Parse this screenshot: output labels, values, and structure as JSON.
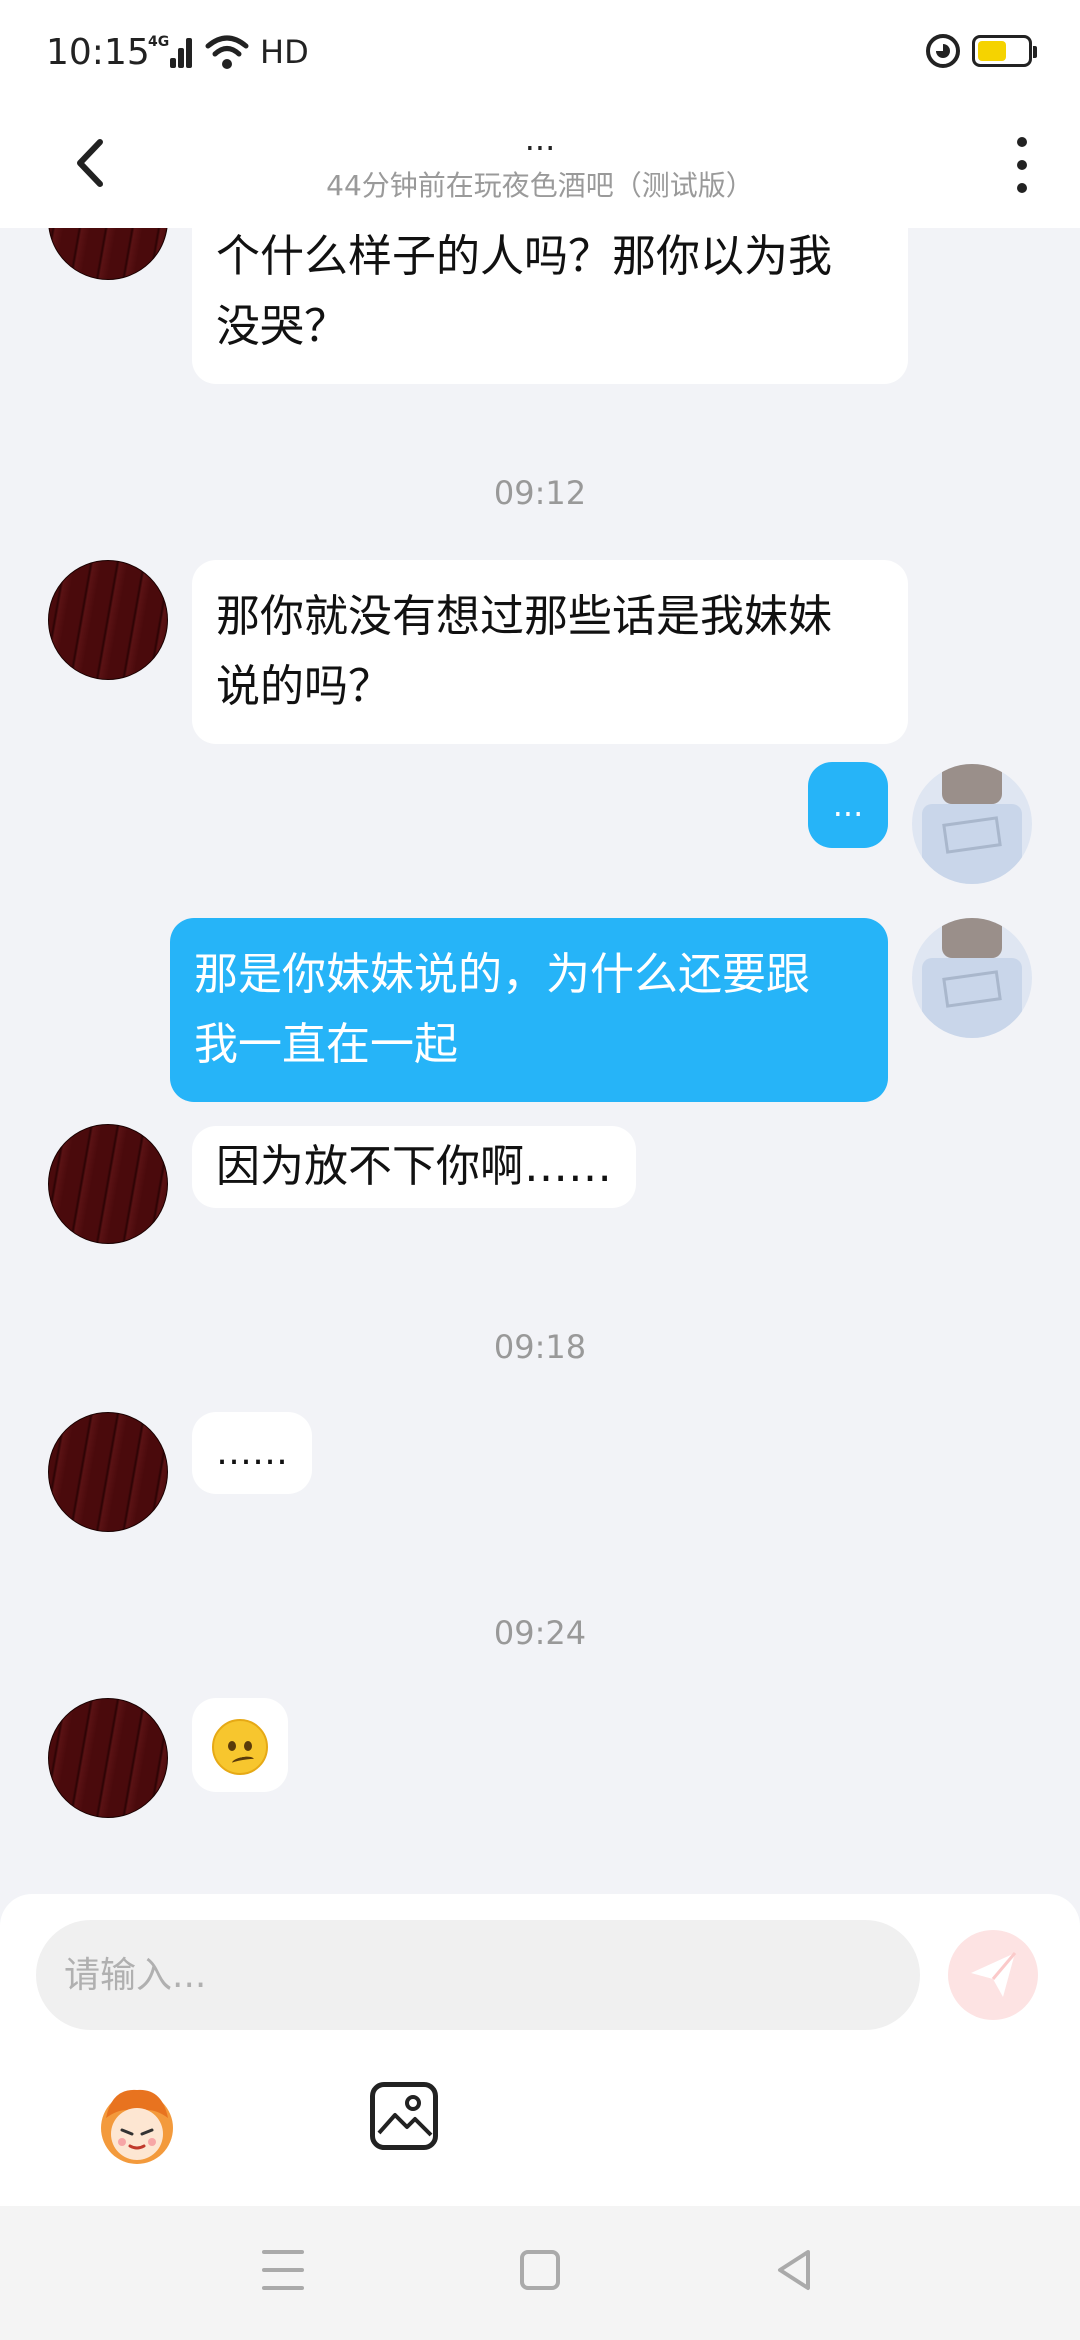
{
  "status_bar": {
    "time": "10:15",
    "network": "4G",
    "hd": "HD",
    "battery_level": 0.5,
    "battery_color": "#f5d300"
  },
  "header": {
    "title": "...",
    "subtitle": "44分钟前在玩夜色酒吧（测试版）",
    "back_icon": "chevron-left-icon",
    "more_icon": "more-vertical-icon"
  },
  "messages": [
    {
      "from": "other",
      "text": "个什么样子的人吗？那你以为我"
    },
    {
      "from": "other",
      "text": "没哭？"
    },
    {
      "timestamp": "09:12"
    },
    {
      "from": "other",
      "text": "那你就没有想过那些话是我妹妹"
    },
    {
      "from": "other",
      "text": "说的吗？"
    },
    {
      "from": "me",
      "text": "..."
    },
    {
      "from": "me",
      "text": "那是你妹妹说的，为什么还要跟"
    },
    {
      "from": "me",
      "text": "我一直在一起"
    },
    {
      "from": "other",
      "text": "因为放不下你啊……"
    },
    {
      "timestamp": "09:18"
    },
    {
      "from": "other",
      "text": "……"
    },
    {
      "timestamp": "09:24"
    },
    {
      "from": "other",
      "emoji": "confused-face-icon"
    }
  ],
  "input": {
    "placeholder": "请输入...",
    "send_icon": "send-icon",
    "mascot_icon": "mascot-sticker-icon",
    "image_icon": "image-icon"
  },
  "nav_bar": {
    "menu_icon": "menu-icon",
    "home_icon": "home-square-icon",
    "back_icon": "back-triangle-icon"
  },
  "colors": {
    "my_bubble": "#26b4f8",
    "other_bubble": "#ffffff",
    "chat_bg": "#f2f3f7"
  }
}
